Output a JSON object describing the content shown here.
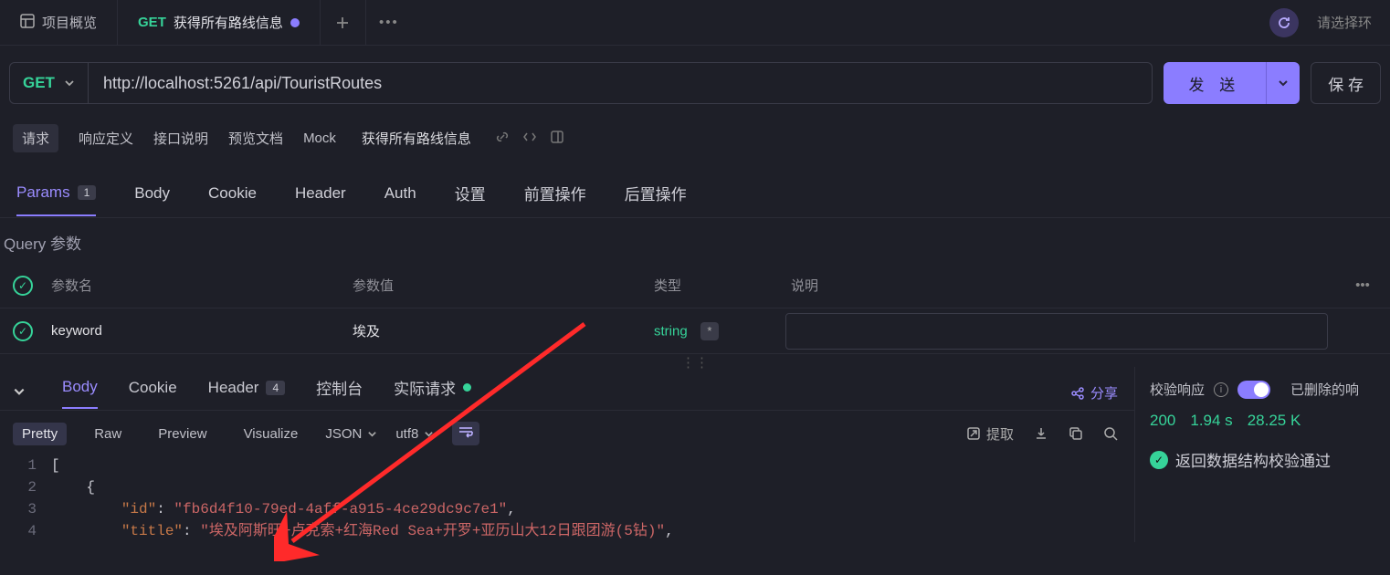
{
  "tabs": {
    "overview": "项目概览",
    "active": {
      "method": "GET",
      "title": "获得所有路线信息",
      "modified": true
    },
    "env_placeholder": "请选择环"
  },
  "request": {
    "method": "GET",
    "url": "http://localhost:5261/api/TouristRoutes",
    "send_label": "发 送",
    "save_label": "保 存"
  },
  "nav": {
    "items": [
      "请求",
      "响应定义",
      "接口说明",
      "预览文档",
      "Mock"
    ],
    "breadcrumb_title": "获得所有路线信息"
  },
  "subtabs": {
    "params": {
      "label": "Params",
      "count": "1"
    },
    "body": "Body",
    "cookie": "Cookie",
    "header": "Header",
    "auth": "Auth",
    "settings": "设置",
    "pre": "前置操作",
    "post": "后置操作"
  },
  "query_section_title": "Query 参数",
  "params_cols": {
    "name": "参数名",
    "value": "参数值",
    "type": "类型",
    "desc": "说明"
  },
  "params_rows": [
    {
      "name": "keyword",
      "value": "埃及",
      "type": "string"
    }
  ],
  "resp_tabs": {
    "body": "Body",
    "cookie": "Cookie",
    "header": {
      "label": "Header",
      "count": "4"
    },
    "console": "控制台",
    "actual": "实际请求",
    "share": "分享"
  },
  "resp_toolbar": {
    "pretty": "Pretty",
    "raw": "Raw",
    "preview": "Preview",
    "visualize": "Visualize",
    "format": "JSON",
    "encoding": "utf8",
    "extract": "提取"
  },
  "resp_right": {
    "validate_label": "校验响应",
    "deleted_label": "已删除的响",
    "status_code": "200",
    "time": "1.94 s",
    "size": "28.25 K",
    "validate_result": "返回数据结构校验通过"
  },
  "code": {
    "line1": "[",
    "line2": "    {",
    "l3_key": "\"id\"",
    "l3_val": "\"fb6d4f10-79ed-4aff-a915-4ce29dc9c7e1\"",
    "l4_key": "\"title\"",
    "l4_val": "\"埃及阿斯旺+卢克索+红海Red Sea+开罗+亚历山大12日跟团游(5钻)\""
  }
}
